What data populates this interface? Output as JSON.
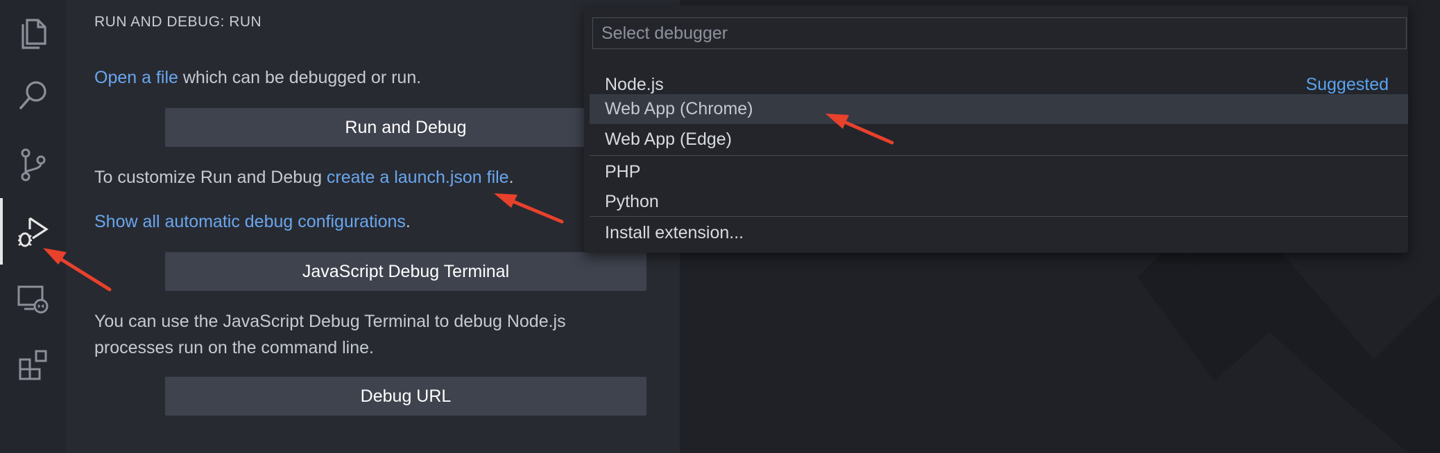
{
  "activity_bar": {
    "items": [
      {
        "icon": "files-icon"
      },
      {
        "icon": "search-icon"
      },
      {
        "icon": "source-control-icon"
      },
      {
        "icon": "run-debug-icon",
        "active": true
      },
      {
        "icon": "remote-explorer-icon"
      },
      {
        "icon": "extensions-icon"
      }
    ]
  },
  "side_panel": {
    "title": "RUN AND DEBUG: RUN",
    "open_file_link": "Open a file",
    "open_file_rest": " which can be debugged or run.",
    "run_debug_button": "Run and Debug",
    "customize_prefix": "To customize Run and Debug ",
    "launch_json_link": "create a launch.json file",
    "customize_suffix": ".",
    "show_configs_link": "Show all automatic debug configurations",
    "show_configs_suffix": ".",
    "js_terminal_button": "JavaScript Debug Terminal",
    "terminal_desc_line1": "You can use the JavaScript Debug Terminal to debug Node.js",
    "terminal_desc_line2": "processes run on the command line.",
    "debug_url_button": "Debug URL"
  },
  "quick_pick": {
    "placeholder": "Select debugger",
    "items": [
      {
        "label": "Node.js",
        "badge": "Suggested"
      },
      {
        "label": "Web App (Chrome)",
        "badge": ""
      },
      {
        "label": "Web App (Edge)",
        "badge": ""
      },
      {
        "label": "PHP",
        "badge": ""
      },
      {
        "label": "Python",
        "badge": ""
      },
      {
        "label": "Install extension...",
        "badge": ""
      }
    ],
    "selected_label": "Web App (Chrome)"
  },
  "colors": {
    "link": "#6aa6ee",
    "annotation_arrow": "#e8412c",
    "button_bg": "#3f434e"
  }
}
